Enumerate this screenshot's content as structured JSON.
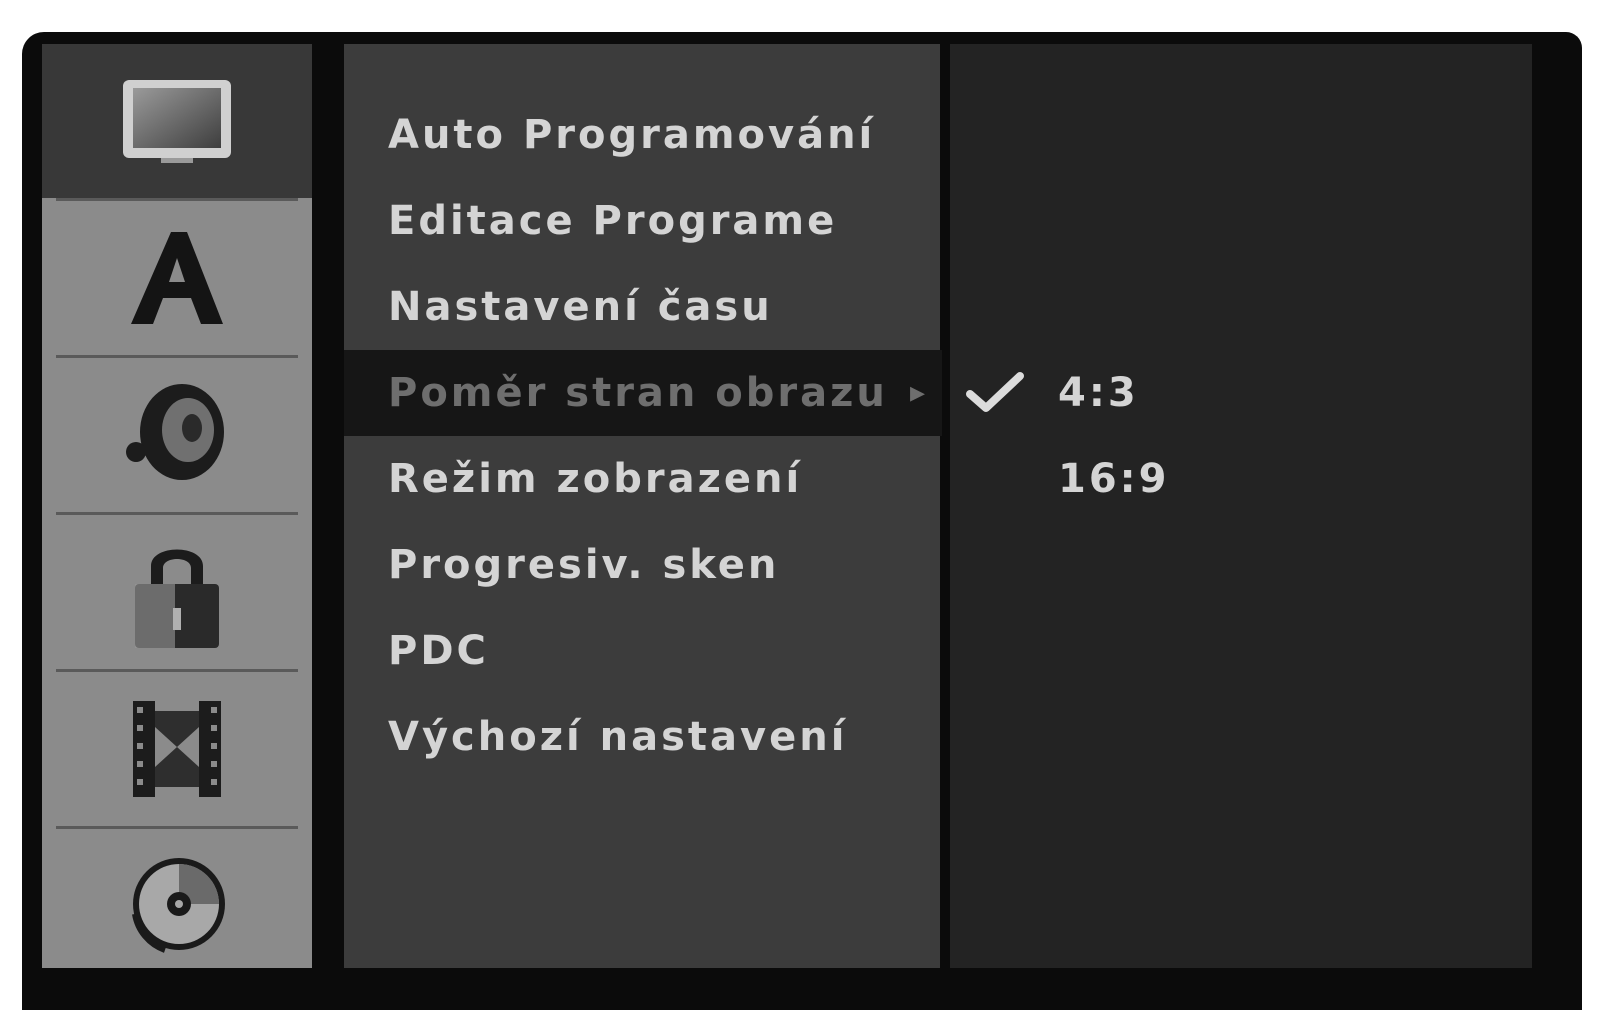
{
  "sidebar": {
    "items": [
      {
        "icon": "tv-screen-icon",
        "active": true
      },
      {
        "icon": "language-icon"
      },
      {
        "icon": "speaker-icon"
      },
      {
        "icon": "lock-icon"
      },
      {
        "icon": "film-icon"
      },
      {
        "icon": "disc-icon"
      }
    ]
  },
  "menu": {
    "items": [
      {
        "label": "Auto Programování"
      },
      {
        "label": "Editace Programe"
      },
      {
        "label": "Nastavení času"
      },
      {
        "label": "Poměr stran obrazu",
        "selected": true
      },
      {
        "label": "Režim zobrazení"
      },
      {
        "label": "Progresiv. sken"
      },
      {
        "label": "PDC"
      },
      {
        "label": "Výchozí nastavení"
      }
    ],
    "arrow": "▸"
  },
  "options": {
    "items": [
      {
        "label": "4:3",
        "checked": true
      },
      {
        "label": "16:9",
        "checked": false
      }
    ]
  },
  "colors": {
    "screen_bg": "#0b0b0b",
    "sidebar_bg": "#8b8b8b",
    "sidebar_active_bg": "#383838",
    "menu_bg": "#3c3c3c",
    "menu_selected_bg": "#161616",
    "options_bg": "#232323",
    "text": "#d4d4d4",
    "text_dim": "#6e6e6e"
  }
}
